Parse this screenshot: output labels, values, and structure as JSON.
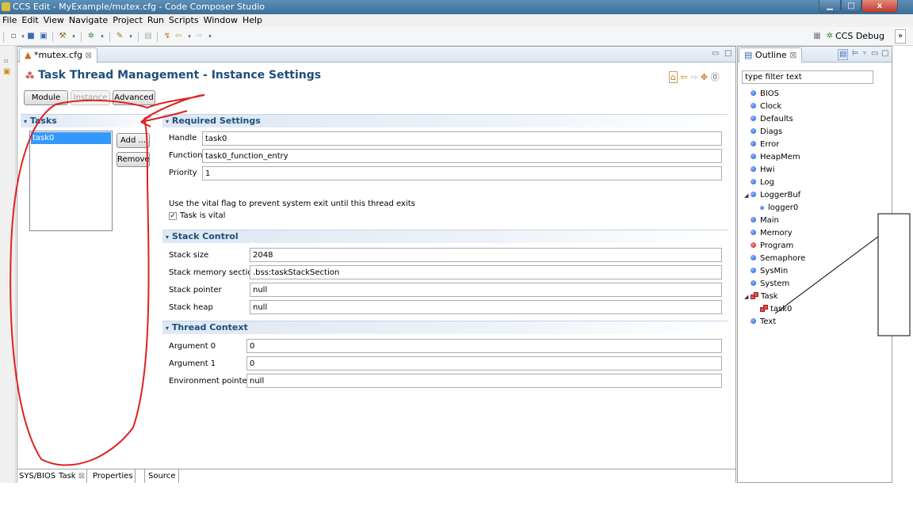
{
  "window": {
    "title": "CCS Edit - MyExample/mutex.cfg - Code Composer Studio",
    "minimize_glyph": "▁",
    "maximize_glyph": "□",
    "close_glyph": "x"
  },
  "menu": [
    "File",
    "Edit",
    "View",
    "Navigate",
    "Project",
    "Run",
    "Scripts",
    "Window",
    "Help"
  ],
  "toolbar": {
    "perspective_label": "CCS Debug",
    "overflow_glyph": "»"
  },
  "editor": {
    "tab_label": "*mutex.cfg",
    "close_glyph": "⊠",
    "title": "Task Thread Management - Instance Settings",
    "mode_buttons": [
      "Module",
      "Instance",
      "Advanced"
    ],
    "tasks_section": "Tasks",
    "tasks": [
      "task0"
    ],
    "add_label": "Add ...",
    "remove_label": "Remove",
    "required_section": "Required Settings",
    "handle_label": "Handle",
    "handle_value": "task0",
    "function_label": "Function",
    "function_value": "task0_function_entry",
    "priority_label": "Priority",
    "priority_value": "1",
    "vital_hint": "Use the vital flag to prevent system exit until this thread exits",
    "vital_label": "Task is vital",
    "vital_checked": true,
    "stack_section": "Stack Control",
    "stack_size_label": "Stack size",
    "stack_size_value": "2048",
    "stack_section_label": "Stack memory section",
    "stack_section_value": ".bss:taskStackSection",
    "stack_pointer_label": "Stack pointer",
    "stack_pointer_value": "null",
    "stack_heap_label": "Stack heap",
    "stack_heap_value": "null",
    "thread_section": "Thread Context",
    "arg0_label": "Argument 0",
    "arg0_value": "0",
    "arg1_label": "Argument 1",
    "arg1_value": "0",
    "env_label": "Environment pointer",
    "env_value": "null",
    "bottom_tabs": [
      "SYS/BIOS",
      "Task",
      "Properties",
      "Source"
    ]
  },
  "outline": {
    "tab_label": "Outline",
    "close_glyph": "⊠",
    "filter_placeholder": "type filter text",
    "items": [
      "BIOS",
      "Clock",
      "Defaults",
      "Diags",
      "Error",
      "HeapMem",
      "Hwi",
      "Log",
      "LoggerBuf",
      "logger0",
      "Main",
      "Memory",
      "Program",
      "Semaphore",
      "SysMin",
      "System",
      "Task",
      "task0",
      "Text"
    ]
  },
  "colors": {
    "accent_title": "#1f4e79",
    "selection": "#3399ff",
    "annotation_red": "#e02020"
  }
}
